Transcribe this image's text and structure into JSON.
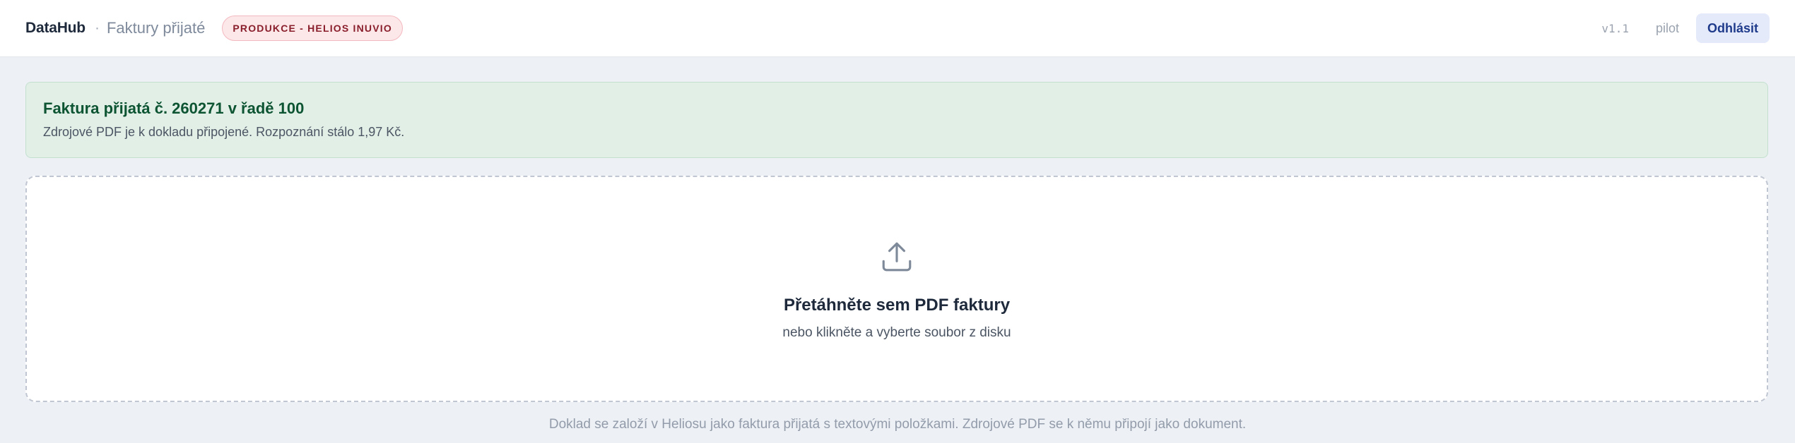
{
  "header": {
    "brand": "DataHub",
    "separator": "·",
    "section": "Faktury přijaté",
    "environment_badge": "PRODUKCE - HELIOS INUVIO",
    "version": "v1.1",
    "user": "pilot",
    "logout_label": "Odhlásit"
  },
  "success": {
    "title": "Faktura přijatá č. 260271 v řadě 100",
    "message": "Zdrojové PDF je k dokladu připojené. Rozpoznání stálo 1,97 Kč."
  },
  "dropzone": {
    "icon": "upload-icon",
    "title": "Přetáhněte sem PDF faktury",
    "subtitle": "nebo klikněte a vyberte soubor z disku"
  },
  "footer": {
    "note": "Doklad se založí v Heliosu jako faktura přijatá s textovými položkami. Zdrojové PDF se k němu připojí jako dokument."
  },
  "colors": {
    "page_bg": "#edf0f4",
    "success_bg": "#e1efe7",
    "success_title": "#0d5432",
    "badge_bg": "#fce7e9",
    "badge_text": "#8a1f2c",
    "logout_bg": "#e5eafb",
    "logout_text": "#1e3a8a"
  }
}
